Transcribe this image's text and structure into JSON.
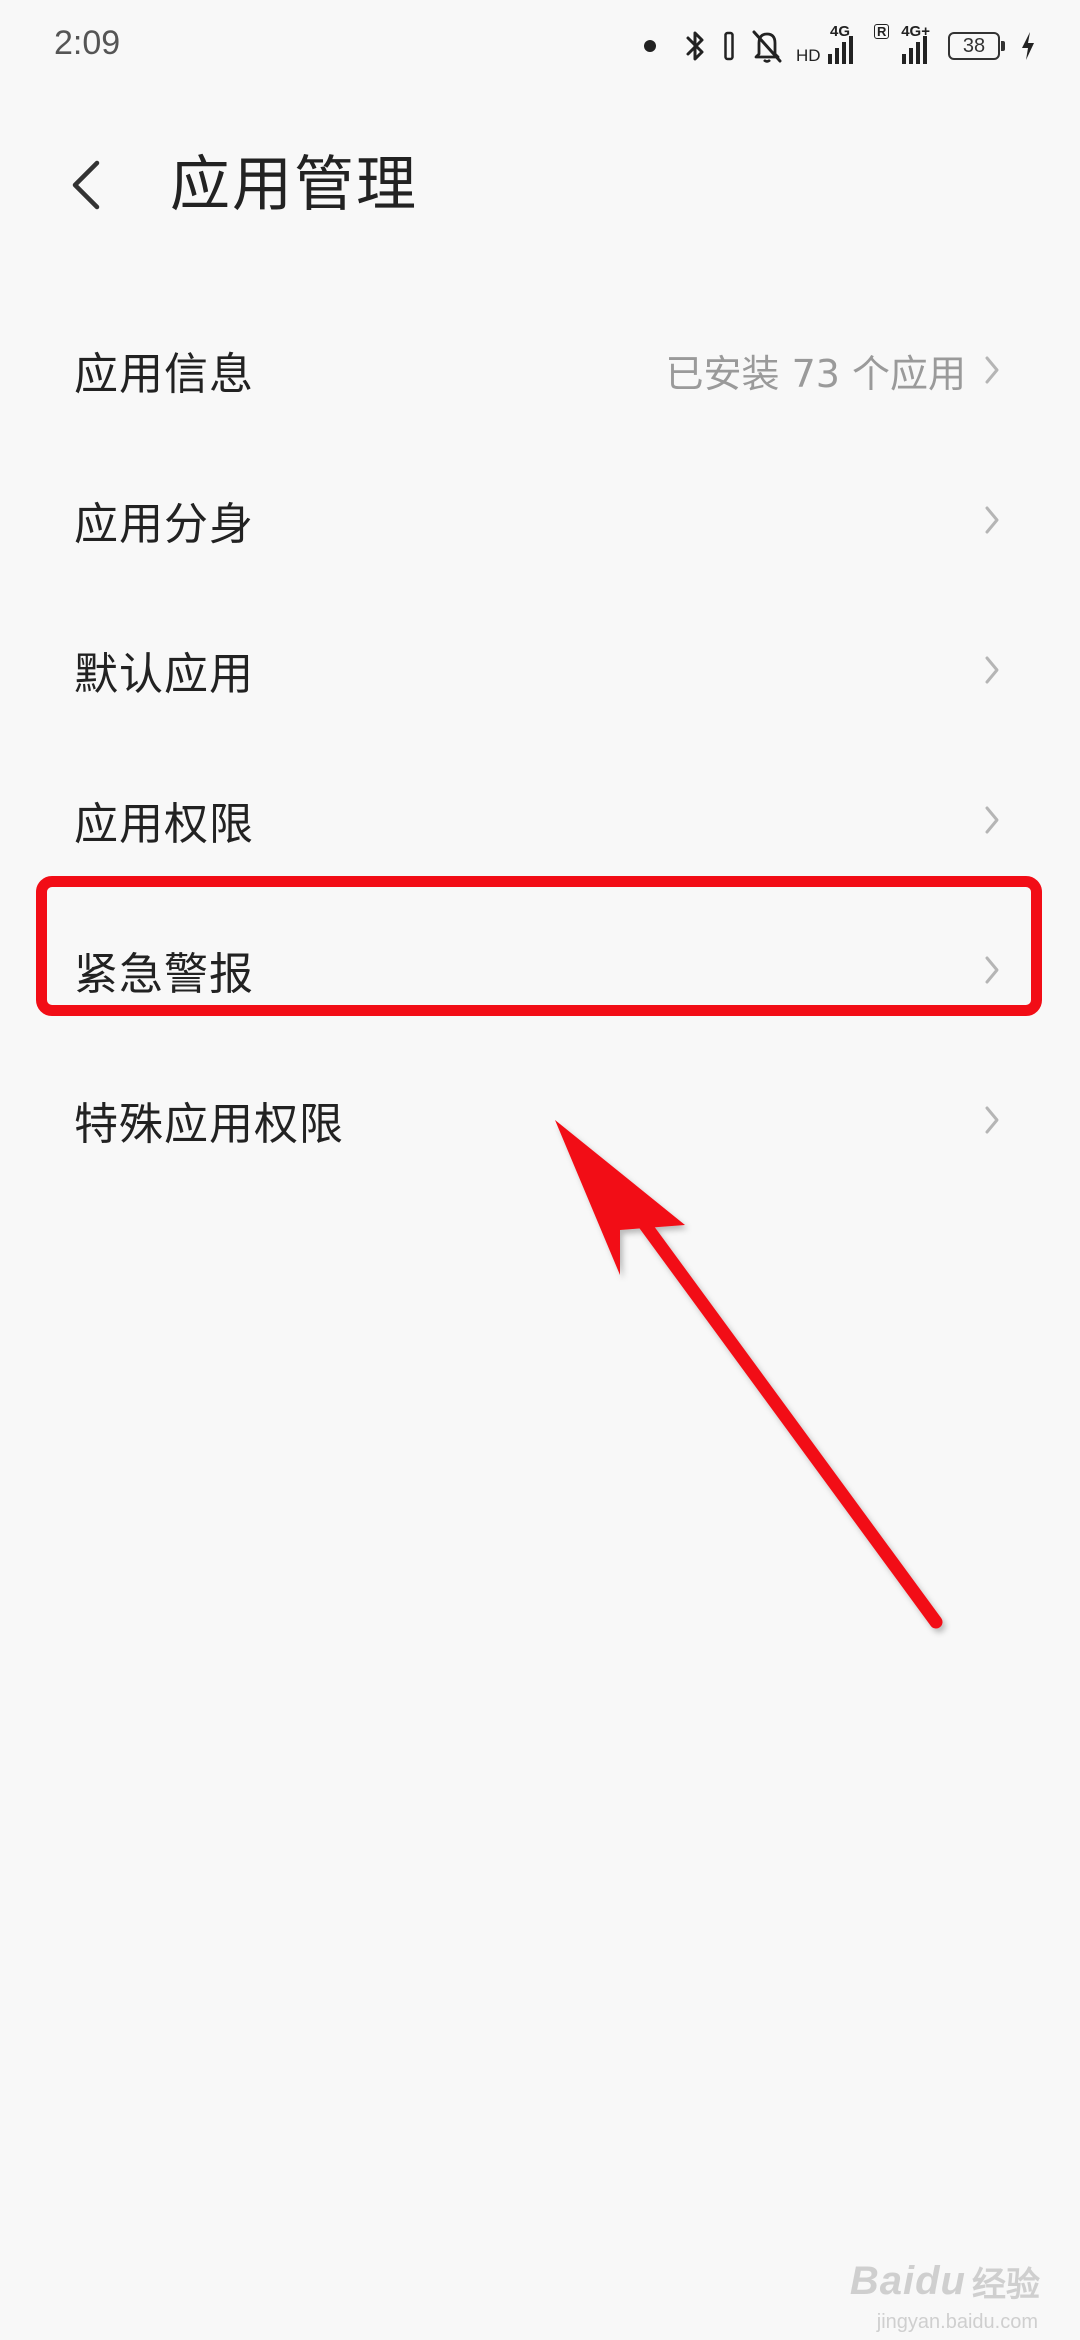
{
  "status_bar": {
    "time": "2:09",
    "net1_tag": "4G",
    "net1_hd": "HD",
    "net2_tag": "4G+",
    "net2_roam": "R",
    "battery_level": "38",
    "icons": [
      "notification-dot-icon",
      "bluetooth-icon",
      "vibrate-icon",
      "mute-bell-icon",
      "signal-icon",
      "signal-icon",
      "battery-icon",
      "charging-icon"
    ]
  },
  "header": {
    "title": "应用管理",
    "back_icon": "chevron-left-icon"
  },
  "settings": {
    "items": [
      {
        "label": "应用信息",
        "value": "已安装 73 个应用"
      },
      {
        "label": "应用分身",
        "value": ""
      },
      {
        "label": "默认应用",
        "value": ""
      },
      {
        "label": "应用权限",
        "value": ""
      },
      {
        "label": "紧急警报",
        "value": ""
      },
      {
        "label": "特殊应用权限",
        "value": ""
      }
    ]
  },
  "annotation": {
    "highlight_color": "#f20d16",
    "arrow_color": "#f20d16"
  },
  "watermark": {
    "logo": "Baidu",
    "suffix": "经验",
    "url": "jingyan.baidu.com"
  },
  "colors": {
    "background": "#f8f8f8",
    "text_primary": "#222222",
    "text_secondary": "#9a9a9a"
  }
}
